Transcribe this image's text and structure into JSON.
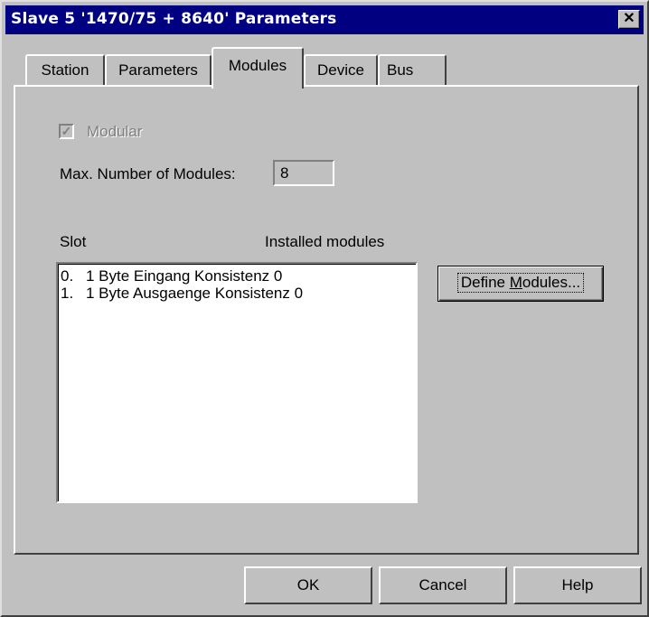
{
  "window": {
    "title": "Slave 5 '1470/75 + 8640' Parameters",
    "close_glyph": "✕"
  },
  "tabs": [
    {
      "label": "Station",
      "active": false
    },
    {
      "label": "Parameters",
      "active": false
    },
    {
      "label": "Modules",
      "active": true
    },
    {
      "label": "Device",
      "active": false
    },
    {
      "label": "Bus",
      "active": false
    }
  ],
  "modules": {
    "modular_label": "Modular",
    "modular_checked": true,
    "modular_enabled": false,
    "max_modules_label": "Max. Number of Modules:",
    "max_modules_value": "8",
    "slot_header": "Slot",
    "installed_header": "Installed modules",
    "installed": [
      {
        "slot": "0.",
        "module": "1 Byte Eingang Konsistenz 0"
      },
      {
        "slot": "1.",
        "module": "1 Byte Ausgaenge Konsistenz 0"
      }
    ],
    "define_button_pre": "Define ",
    "define_button_accel": "M",
    "define_button_post": "odules..."
  },
  "footer": {
    "ok_label": "OK",
    "cancel_label": "Cancel",
    "help_label": "Help"
  }
}
